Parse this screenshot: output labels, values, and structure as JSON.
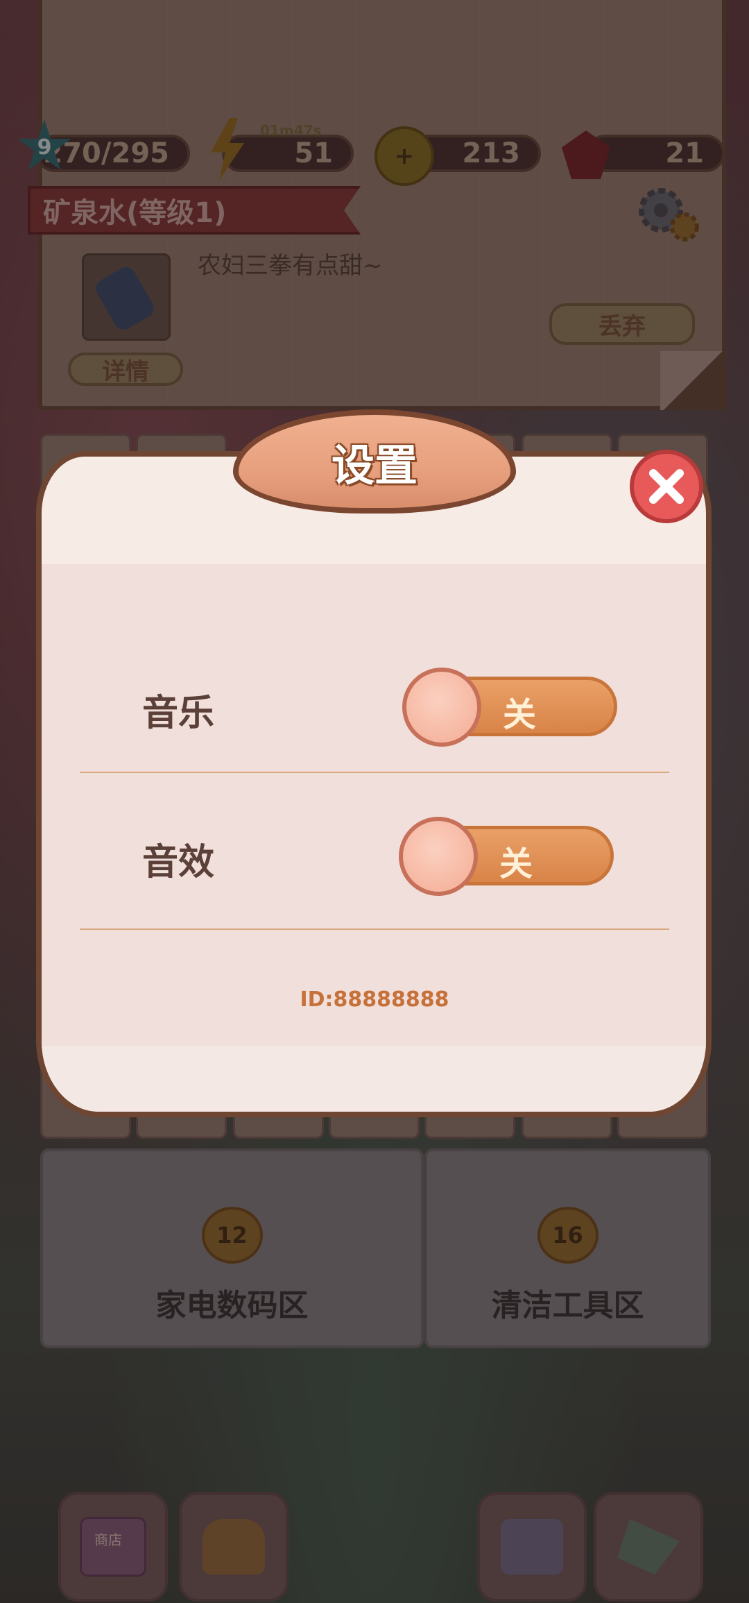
{
  "hud": {
    "level": "9",
    "xp": "270/295",
    "energy_timer": "01m47s",
    "energy": "51",
    "coins": "213",
    "gems": "21"
  },
  "item": {
    "title": "矿泉水(等级1)",
    "description": "农妇三拳有点甜~",
    "details_label": "详情",
    "discard_label": "丢弃"
  },
  "zones": [
    {
      "lock_level": "12",
      "label": "家电数码区"
    },
    {
      "lock_level": "16",
      "label": "清洁工具区"
    }
  ],
  "settings": {
    "title": "设置",
    "music_label": "音乐",
    "music_state": "关",
    "sfx_label": "音效",
    "sfx_state": "关",
    "player_id": "ID:88888888"
  },
  "bottom_nav": {
    "shop_sign": "商店"
  },
  "colors": {
    "accent_orange": "#d98448",
    "close_red": "#e85a5a",
    "dialog_border": "#6e4632",
    "id_text": "#c6713a"
  }
}
